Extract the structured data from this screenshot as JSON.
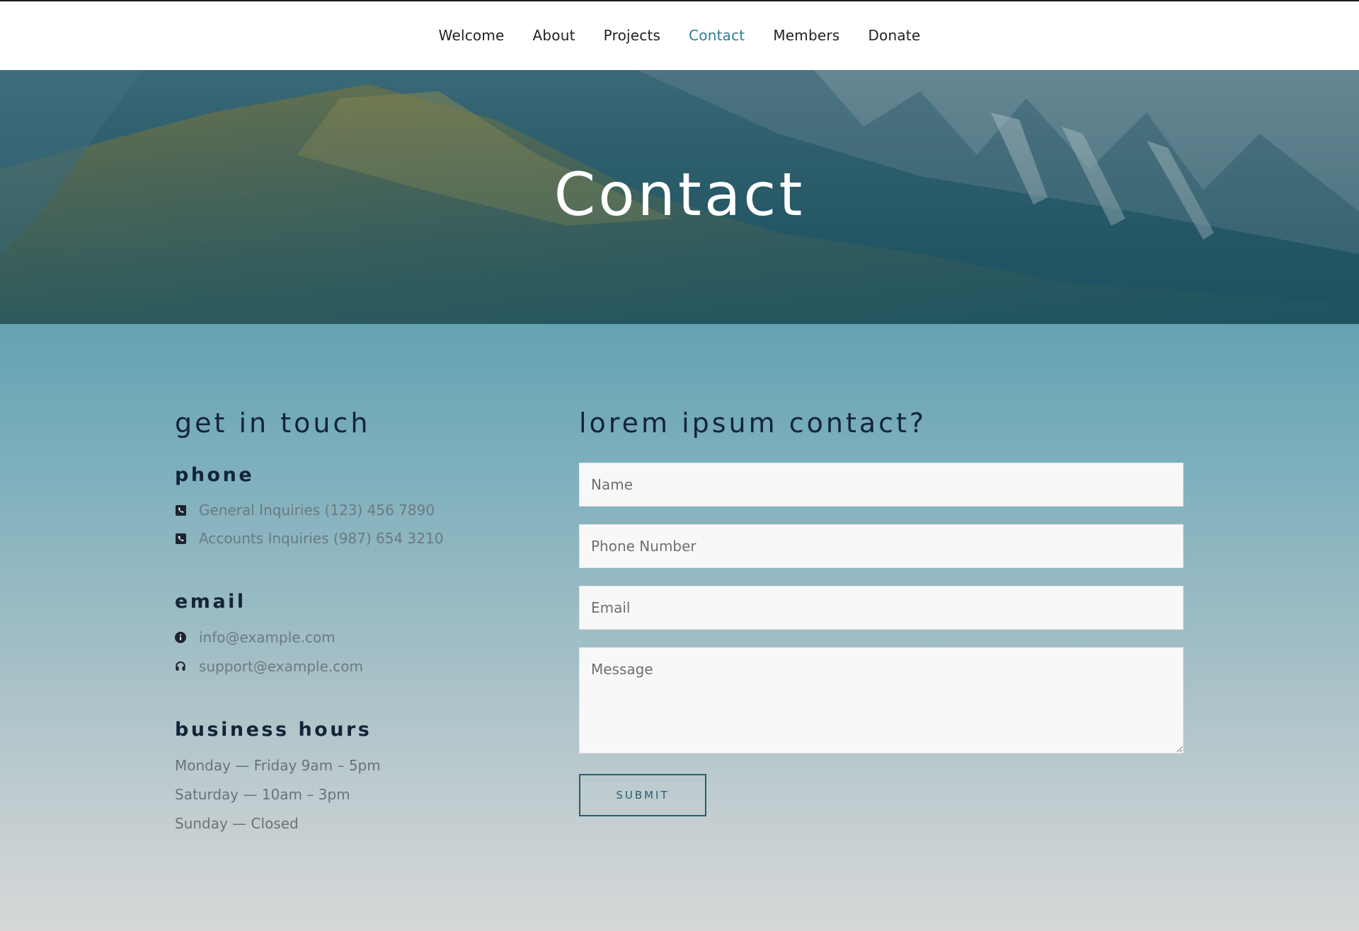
{
  "nav": {
    "items": [
      {
        "label": "Welcome",
        "active": false
      },
      {
        "label": "About",
        "active": false
      },
      {
        "label": "Projects",
        "active": false
      },
      {
        "label": "Contact",
        "active": true
      },
      {
        "label": "Members",
        "active": false
      },
      {
        "label": "Donate",
        "active": false
      }
    ]
  },
  "hero": {
    "title": "Contact"
  },
  "left": {
    "heading": "get in touch",
    "phone": {
      "heading": "phone",
      "items": [
        {
          "icon": "phone-square-icon",
          "text": "General Inquiries (123) 456 7890"
        },
        {
          "icon": "phone-square-icon",
          "text": "Accounts Inquiries (987) 654 3210"
        }
      ]
    },
    "email": {
      "heading": "email",
      "items": [
        {
          "icon": "info-circle-icon",
          "text": "info@example.com"
        },
        {
          "icon": "headset-icon",
          "text": "support@example.com"
        }
      ]
    },
    "hours": {
      "heading": "business hours",
      "items": [
        "Monday — Friday 9am – 5pm",
        "Saturday — 10am – 3pm",
        "Sunday — Closed"
      ]
    }
  },
  "form": {
    "heading": "lorem ipsum contact?",
    "name_placeholder": "Name",
    "phone_placeholder": "Phone Number",
    "email_placeholder": "Email",
    "message_placeholder": "Message",
    "submit_label": "SUBMIT"
  },
  "colors": {
    "accent": "#2f7c94",
    "heading": "#13243a",
    "button_border": "#235f72"
  }
}
